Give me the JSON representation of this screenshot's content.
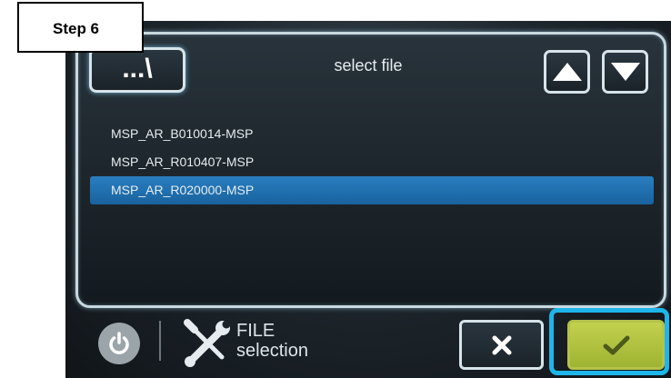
{
  "overlay": {
    "step_label": "Step 6"
  },
  "header": {
    "path_button_label": "...\\",
    "title": "select file"
  },
  "file_list": [
    {
      "name": "MSP_AR_B010014-MSP",
      "selected": false
    },
    {
      "name": "MSP_AR_R010407-MSP",
      "selected": false
    },
    {
      "name": "MSP_AR_R020000-MSP",
      "selected": true
    }
  ],
  "footer": {
    "title_line1": "FILE",
    "title_line2": "selection"
  },
  "icons": {
    "up": "up-triangle",
    "down": "down-triangle",
    "power": "power",
    "tools": "wrench-screwdriver",
    "cancel": "x-mark",
    "confirm": "check-mark"
  },
  "colors": {
    "selection": "#1f6fb0",
    "highlight": "#1eb6ea",
    "confirm": "#b3c440"
  }
}
